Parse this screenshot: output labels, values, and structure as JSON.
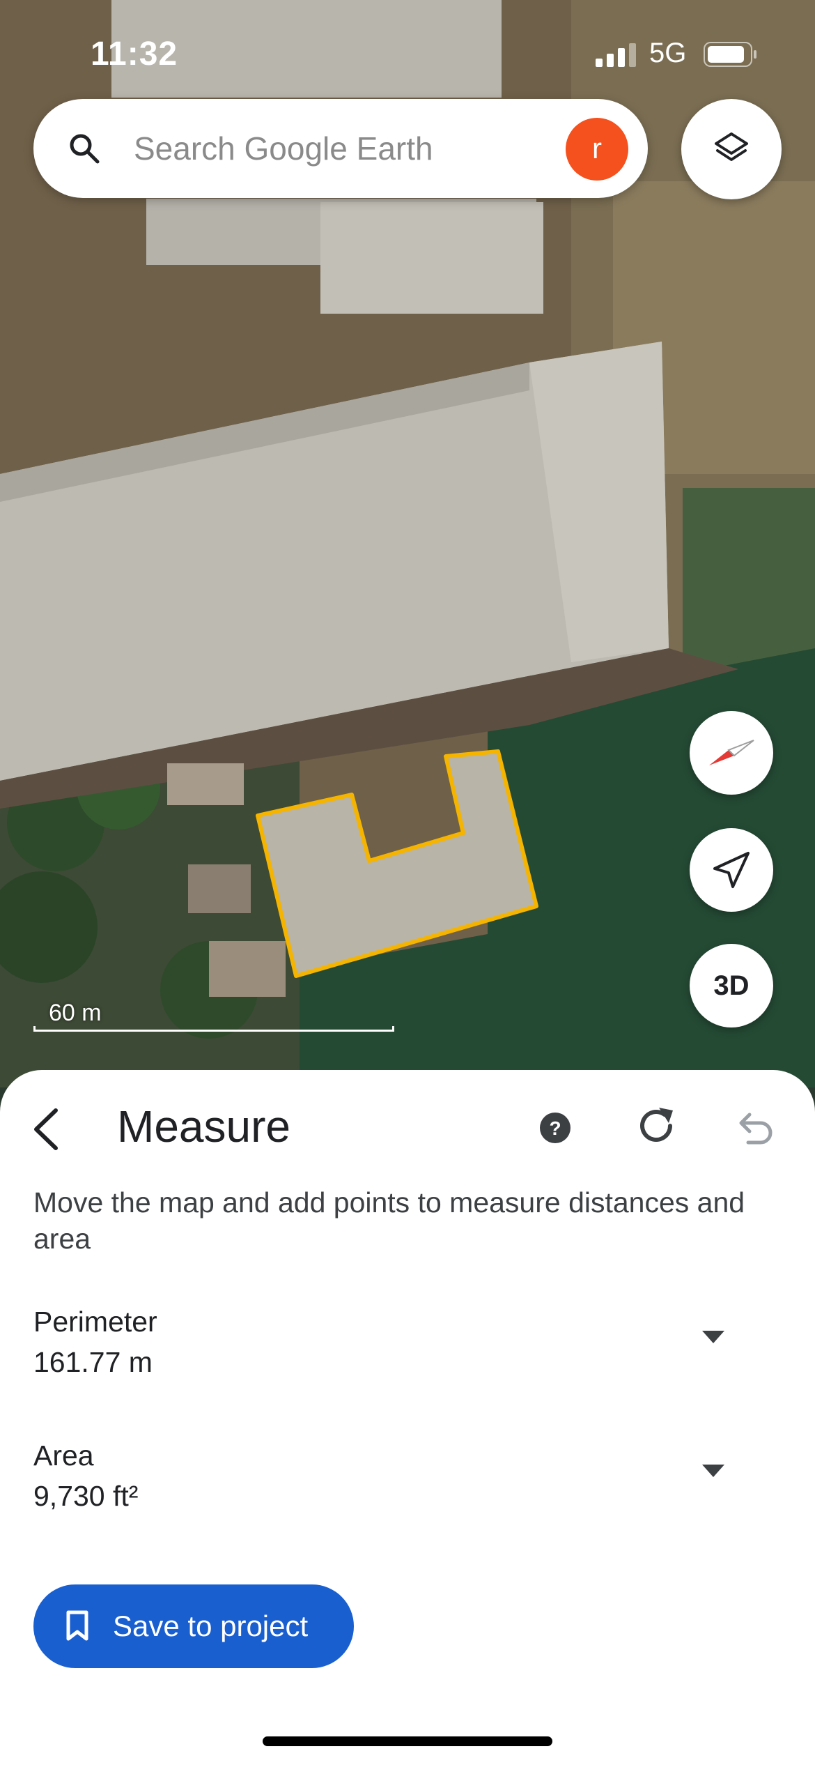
{
  "status_bar": {
    "time": "11:32",
    "network": "5G"
  },
  "search": {
    "placeholder": "Search Google Earth",
    "avatar_letter": "r"
  },
  "map": {
    "scale_label": "60 m",
    "compass_icon": "compass-icon",
    "locate_icon": "location-arrow-icon",
    "threed_label": "3D",
    "layers_icon": "layers-icon",
    "measure_outline_color": "#f4b400"
  },
  "measure": {
    "title": "Measure",
    "description": "Move the map and add points to measure distances and area",
    "perimeter_label": "Perimeter",
    "perimeter_value": "161.77 m",
    "area_label": "Area",
    "area_value": "9,730 ft²",
    "save_label": "Save to project"
  },
  "colors": {
    "accent": "#1a5fd0",
    "avatar": "#f4511e"
  }
}
